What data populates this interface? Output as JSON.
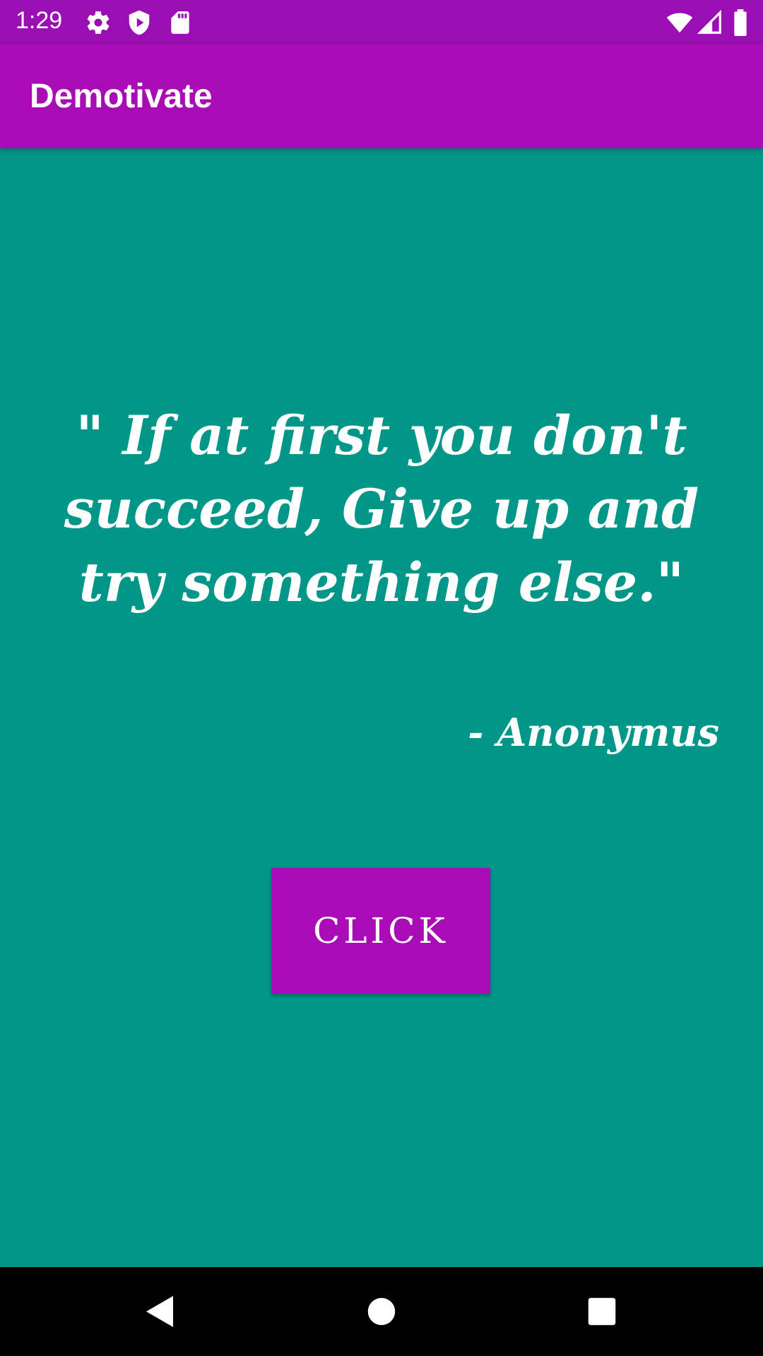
{
  "status_bar": {
    "time": "1:29",
    "icons": [
      "gear-icon",
      "shield-play-icon",
      "sd-card-icon",
      "wifi-icon",
      "signal-icon",
      "battery-icon"
    ]
  },
  "app_bar": {
    "title": "Demotivate"
  },
  "quote": {
    "text": "\" If at first you don't succeed, Give up and try something else.\"",
    "author": "- Anonymus"
  },
  "button": {
    "label": "CLICK"
  },
  "colors": {
    "status_bar": "#9A0FB2",
    "app_bar": "#A70CB5",
    "background": "#009688",
    "button": "#A70CB5",
    "nav_bar": "#000000"
  },
  "nav_bar": {
    "buttons": [
      "back-icon",
      "home-icon",
      "recents-icon"
    ]
  }
}
